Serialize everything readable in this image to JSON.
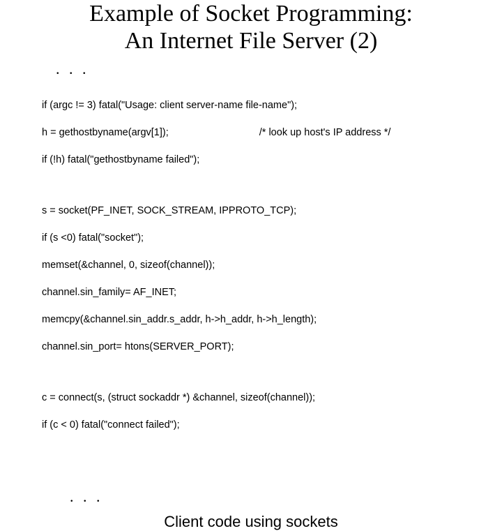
{
  "title_line1": "Example of Socket Programming:",
  "title_line2": "An Internet File Server (2)",
  "ellipsis_top": ".  .  .",
  "ellipsis_bottom": ".  .  .",
  "code": {
    "l1": "if (argc != 3) fatal(\"Usage: client server-name file-name\");",
    "l2a": "h = gethostbyname(argv[1]);",
    "l2b": "/* look up host's IP address */",
    "l3": "if (!h) fatal(\"gethostbyname failed\");",
    "l4": "s = socket(PF_INET, SOCK_STREAM, IPPROTO_TCP);",
    "l5": "if (s <0) fatal(\"socket\");",
    "l6": "memset(&channel, 0, sizeof(channel));",
    "l7": "channel.sin_family= AF_INET;",
    "l8": "memcpy(&channel.sin_addr.s_addr, h->h_addr, h->h_length);",
    "l9": "channel.sin_port= htons(SERVER_PORT);",
    "l10": "c = connect(s, (struct sockaddr *) &channel, sizeof(channel));",
    "l11": "if (c < 0) fatal(\"connect failed\");"
  },
  "caption": "Client code using sockets"
}
